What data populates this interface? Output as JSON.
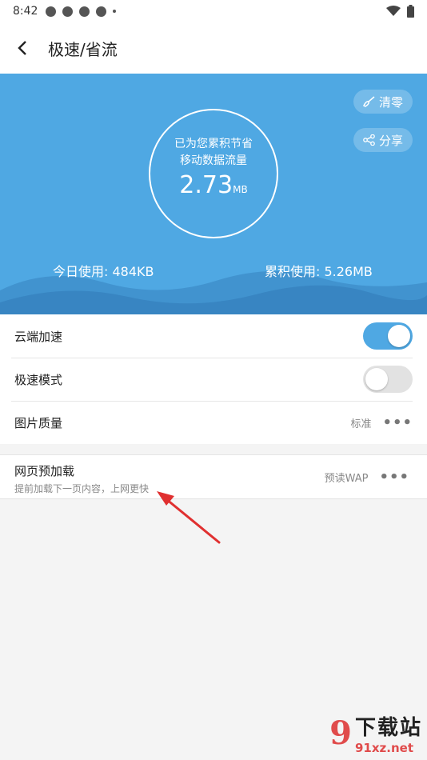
{
  "status_bar": {
    "time": "8:42"
  },
  "header": {
    "title": "极速/省流"
  },
  "hero": {
    "saved_line1": "已为您累积节省",
    "saved_line2": "移动数据流量",
    "saved_value": "2.73",
    "saved_unit": "MB",
    "clear_label": "清零",
    "share_label": "分享",
    "today_usage": "今日使用: 484KB",
    "total_usage": "累积使用: 5.26MB",
    "colors": {
      "background": "#4fa8e3"
    }
  },
  "settings": {
    "cloud_accel": {
      "label": "云端加速",
      "on": true
    },
    "speed_mode": {
      "label": "极速模式",
      "on": false
    },
    "image_quality": {
      "label": "图片质量",
      "value": "标准",
      "more": "•••"
    }
  },
  "preload": {
    "title": "网页预加载",
    "description": "提前加载下一页内容，上网更快",
    "value": "预读WAP",
    "more": "•••"
  },
  "watermark": {
    "logo": "9",
    "brand": "下载站",
    "domain": "91xz.net"
  },
  "icons": {
    "back": "chevron-left-icon",
    "clear": "broom-icon",
    "share": "share-icon",
    "wifi": "wifi-icon",
    "battery": "battery-icon"
  },
  "colors": {
    "accent": "#4fa8e3",
    "annotation_arrow": "#e03030"
  }
}
